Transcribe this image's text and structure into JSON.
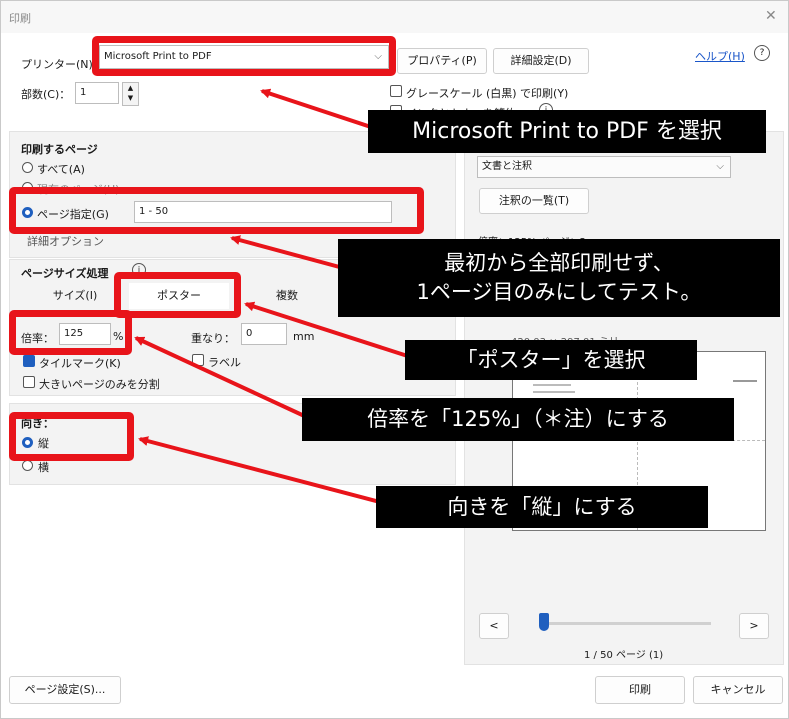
{
  "dialog": {
    "title": "印刷",
    "close_glyph": "✕",
    "help_link": "ヘルプ(H)",
    "help_glyph": "?",
    "info_glyph": "i"
  },
  "printer": {
    "label": "プリンター(N)：",
    "value": "Microsoft Print to PDF",
    "properties_button": "プロパティ(P)",
    "advanced_button": "詳細設定(D)",
    "copies_label": "部数(C)：",
    "copies_value": "1",
    "grayscale_label": "グレースケール (白黒) で印刷(Y)",
    "ink_label": "インクとトナーを節約"
  },
  "pages_to_print": {
    "heading": "印刷するページ",
    "all_label": "すべて(A)",
    "current_label": "現在のページ(U)",
    "specify_label": "ページ指定(G)",
    "range_value": "1 - 50",
    "more_options_label": "詳細オプション"
  },
  "comments": {
    "select_value": "文書と注釈",
    "summary_button": "注釈の一覧(T)"
  },
  "page_sizing": {
    "heading": "ページサイズ処理",
    "tab_size": "サイズ(I)",
    "tab_poster": "ポスター",
    "tab_multiple": "複数",
    "scale_label": "倍率：",
    "scale_value": "125",
    "scale_unit": "%",
    "overlap_label": "重なり：",
    "overlap_value": "0",
    "overlap_unit": "mm",
    "tile_marks_label": "タイルマーク(K)",
    "labels_label": "ラベル",
    "large_only_label": "大きいページのみを分割"
  },
  "orientation": {
    "heading": "向き：",
    "portrait_label": "縦",
    "landscape_label": "横"
  },
  "preview": {
    "scale_info": "倍率：125% ページ：2",
    "paper_size": "420.03 × 297.01 ミリ",
    "page_counter": "1 / 50 ページ (1)",
    "prev_glyph": "<",
    "next_glyph": ">"
  },
  "footer": {
    "page_setup_button": "ページ設定(S)...",
    "print_button": "印刷",
    "cancel_button": "キャンセル"
  },
  "callouts": {
    "select_printer": "Microsoft Print to PDF を選択",
    "range_line1": "最初から全部印刷せず、",
    "range_line2": "1ページ目のみにしてテスト。",
    "select_poster": "「ポスター」を選択",
    "scale_note": "倍率を「125%」（＊注）にする",
    "orientation_note": "向きを「縦」にする"
  },
  "colors": {
    "annotation_red": "#e8141a",
    "callout_bg": "#000000",
    "accent_blue": "#1f5fbf"
  }
}
